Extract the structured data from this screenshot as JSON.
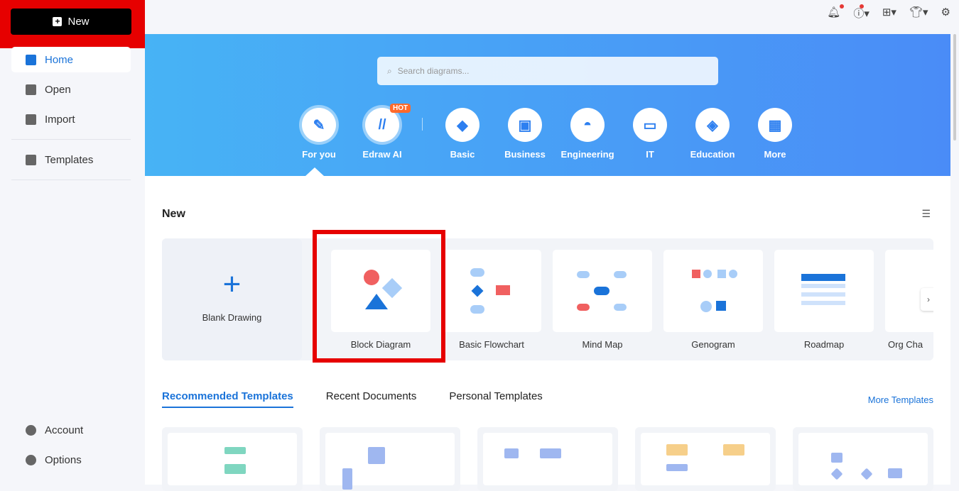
{
  "sidebar": {
    "new_label": "New",
    "items": [
      {
        "label": "Home"
      },
      {
        "label": "Open"
      },
      {
        "label": "Import"
      },
      {
        "label": "Templates"
      }
    ],
    "bottom": [
      {
        "label": "Account"
      },
      {
        "label": "Options"
      }
    ]
  },
  "topbar": {
    "icons": [
      "bell-icon",
      "help-icon",
      "apps-icon",
      "theme-shirt-icon",
      "settings-icon"
    ]
  },
  "search": {
    "placeholder": "Search diagrams..."
  },
  "categories": [
    {
      "label": "For you"
    },
    {
      "label": "Edraw AI",
      "badge": "HOT"
    },
    {
      "label": "Basic"
    },
    {
      "label": "Business"
    },
    {
      "label": "Engineering"
    },
    {
      "label": "IT"
    },
    {
      "label": "Education"
    },
    {
      "label": "More"
    }
  ],
  "new_section": {
    "title": "New",
    "blank": "Blank Drawing",
    "templates": [
      {
        "label": "Block Diagram"
      },
      {
        "label": "Basic Flowchart"
      },
      {
        "label": "Mind Map"
      },
      {
        "label": "Genogram"
      },
      {
        "label": "Roadmap"
      },
      {
        "label": "Org Cha"
      }
    ]
  },
  "tabs": [
    {
      "label": "Recommended Templates"
    },
    {
      "label": "Recent Documents"
    },
    {
      "label": "Personal Templates"
    }
  ],
  "more_templates": "More Templates",
  "colors": {
    "accent": "#1a73d9",
    "highlight": "#e60000"
  }
}
